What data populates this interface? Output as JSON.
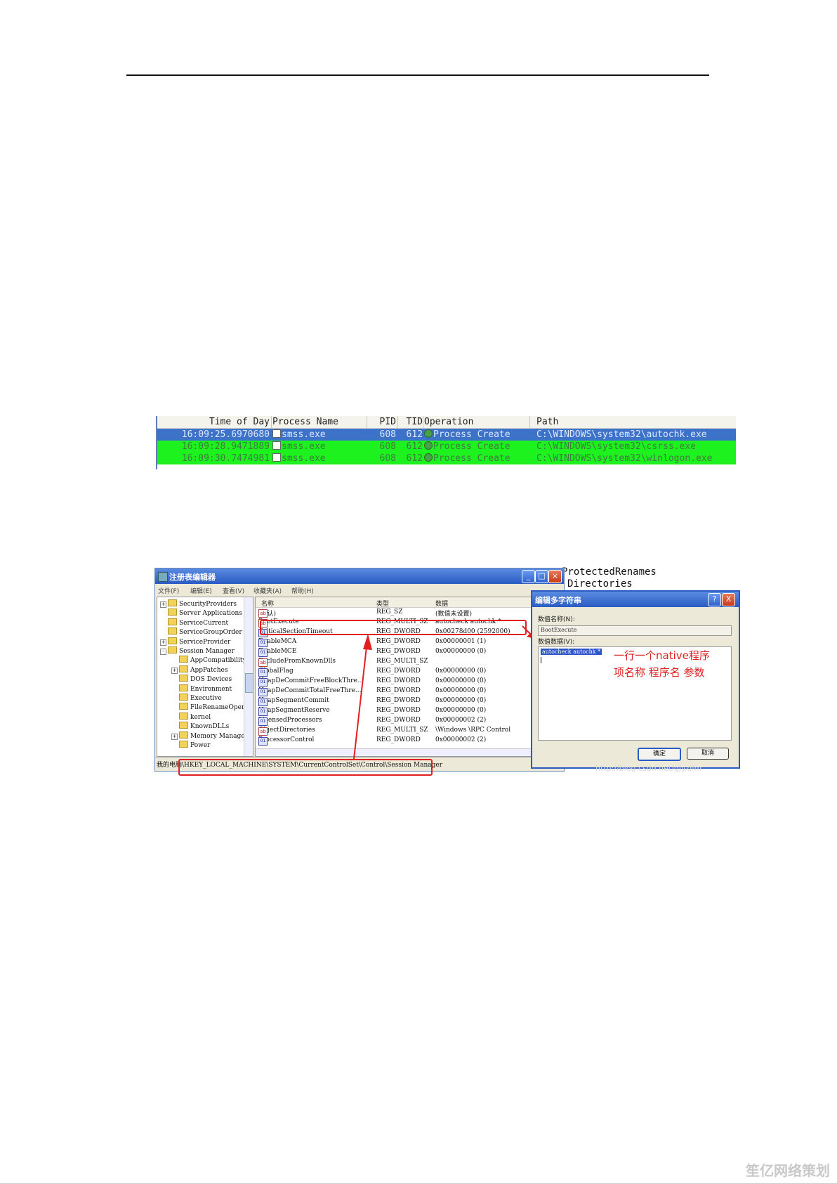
{
  "procmon": {
    "headers": {
      "time": "Time of Day",
      "process": "Process Name",
      "pid": "PID",
      "tid": "TID",
      "operation": "Operation",
      "path": "Path"
    },
    "rows": [
      {
        "time": "16:09:25.6970680",
        "process": "smss.exe",
        "pid": "608",
        "tid": "612",
        "operation": "Process Create",
        "path": "C:\\WINDOWS\\system32\\autochk.exe"
      },
      {
        "time": "16:09:28.9471889",
        "process": "smss.exe",
        "pid": "608",
        "tid": "612",
        "operation": "Process Create",
        "path": "C:\\WINDOWS\\system32\\csrss.exe"
      },
      {
        "time": "16:09:30.7474981",
        "process": "smss.exe",
        "pid": "608",
        "tid": "612",
        "operation": "Process Create",
        "path": "C:\\WINDOWS\\system32\\winlogon.exe"
      }
    ]
  },
  "behind_text": {
    "line1": "ProtectedRenames",
    "line2": "Directories"
  },
  "regedit": {
    "title": "注册表编辑器",
    "menu": [
      "文件(F)",
      "编辑(E)",
      "查看(V)",
      "收藏夹(A)",
      "帮助(H)"
    ],
    "tree": [
      {
        "label": "SecurityProviders",
        "indent": 0,
        "exp": "+"
      },
      {
        "label": "Server Applications",
        "indent": 0,
        "exp": ""
      },
      {
        "label": "ServiceCurrent",
        "indent": 0,
        "exp": ""
      },
      {
        "label": "ServiceGroupOrder",
        "indent": 0,
        "exp": ""
      },
      {
        "label": "ServiceProvider",
        "indent": 0,
        "exp": "+"
      },
      {
        "label": "Session Manager",
        "indent": 0,
        "exp": "-"
      },
      {
        "label": "AppCompatibility",
        "indent": 1,
        "exp": ""
      },
      {
        "label": "AppPatches",
        "indent": 1,
        "exp": "+"
      },
      {
        "label": "DOS Devices",
        "indent": 1,
        "exp": ""
      },
      {
        "label": "Environment",
        "indent": 1,
        "exp": ""
      },
      {
        "label": "Executive",
        "indent": 1,
        "exp": ""
      },
      {
        "label": "FileRenameOperat",
        "indent": 1,
        "exp": ""
      },
      {
        "label": "kernel",
        "indent": 1,
        "exp": ""
      },
      {
        "label": "KnownDLLs",
        "indent": 1,
        "exp": ""
      },
      {
        "label": "Memory Managemer",
        "indent": 1,
        "exp": "+"
      },
      {
        "label": "Power",
        "indent": 1,
        "exp": ""
      }
    ],
    "columns": {
      "name": "名称",
      "type": "类型",
      "data": "数据"
    },
    "values": [
      {
        "icon": "ab",
        "name": "(默认)",
        "type": "REG_SZ",
        "data": "(数值未设置)"
      },
      {
        "icon": "ab",
        "name": "BootExecute",
        "type": "REG_MULTI_SZ",
        "data": "autocheck autochk *"
      },
      {
        "icon": "bin",
        "name": "CriticalSectionTimeout",
        "type": "REG_DWORD",
        "data": "0x00278d00 (2592000)"
      },
      {
        "icon": "bin",
        "name": "EnableMCA",
        "type": "REG_DWORD",
        "data": "0x00000001 (1)"
      },
      {
        "icon": "bin",
        "name": "EnableMCE",
        "type": "REG_DWORD",
        "data": "0x00000000 (0)"
      },
      {
        "icon": "ab",
        "name": "ExcludeFromKnownDlls",
        "type": "REG_MULTI_SZ",
        "data": ""
      },
      {
        "icon": "bin",
        "name": "GlobalFlag",
        "type": "REG_DWORD",
        "data": "0x00000000 (0)"
      },
      {
        "icon": "bin",
        "name": "HeapDeCommitFreeBlockThre...",
        "type": "REG_DWORD",
        "data": "0x00000000 (0)"
      },
      {
        "icon": "bin",
        "name": "HeapDeCommitTotalFreeThre...",
        "type": "REG_DWORD",
        "data": "0x00000000 (0)"
      },
      {
        "icon": "bin",
        "name": "HeapSegmentCommit",
        "type": "REG_DWORD",
        "data": "0x00000000 (0)"
      },
      {
        "icon": "bin",
        "name": "HeapSegmentReserve",
        "type": "REG_DWORD",
        "data": "0x00000000 (0)"
      },
      {
        "icon": "bin",
        "name": "LicensedProcessors",
        "type": "REG_DWORD",
        "data": "0x00000002 (2)"
      },
      {
        "icon": "ab",
        "name": "ObjectDirectories",
        "type": "REG_MULTI_SZ",
        "data": "\\Windows \\RPC Control"
      },
      {
        "icon": "bin",
        "name": "ProcessorControl",
        "type": "REG_DWORD",
        "data": "0x00000002 (2)"
      }
    ],
    "status": "我的电脑\\HKEY_LOCAL_MACHINE\\SYSTEM\\CurrentControlSet\\Control\\Session Manager"
  },
  "dialog": {
    "title": "编辑多字符串",
    "name_label": "数值名称(N):",
    "name_value": "BootExecute",
    "data_label": "数值数据(V):",
    "data_value": "autocheck autochk *",
    "annotation_line1": "一行一个native程序",
    "annotation_line2": "项名称  程序名  参数",
    "ok": "确定",
    "cancel": "取消",
    "help_glyph": "?",
    "close_glyph": "X"
  },
  "watermark_url": "http://blog.csdn.net/gjy.dlm",
  "watermark": "笙亿网络策划",
  "colors": {
    "selected_row": "#3c72c8",
    "green_row": "#1ef21e",
    "highlight": "#e02020"
  }
}
